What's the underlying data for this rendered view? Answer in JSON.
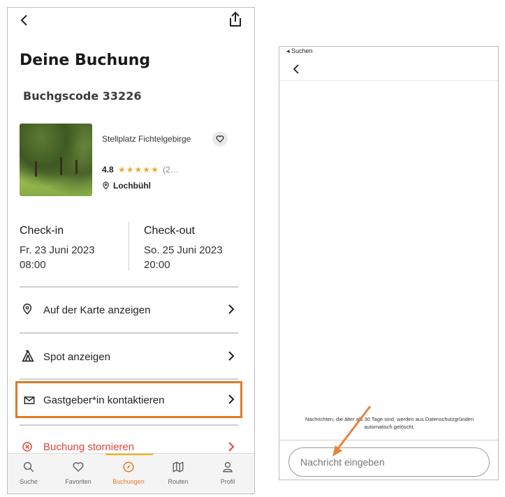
{
  "left_screen": {
    "title": "Deine Buchung",
    "booking_code": "Buchgscode 33226",
    "spot": {
      "name": "Stellplatz Fichtelgebirge",
      "rating": "4.8",
      "stars": "★★★★★",
      "rating_count": "(2…",
      "location": "Lochbühl"
    },
    "checkin": {
      "label": "Check-in",
      "date": "Fr. 23 Juni 2023",
      "time": "08:00"
    },
    "checkout": {
      "label": "Check-out",
      "date": "So. 25 Juni 2023",
      "time": "20:00"
    },
    "actions": [
      {
        "label": "Auf der Karte anzeigen",
        "icon": "map-pin-icon"
      },
      {
        "label": "Spot anzeigen",
        "icon": "tent-icon"
      },
      {
        "label": "Gastgeber*in kontaktieren",
        "icon": "mail-icon"
      },
      {
        "label": "Buchung stornieren",
        "icon": "cancel-icon"
      }
    ],
    "tabs": [
      {
        "label": "Suche",
        "icon": "search-icon",
        "active": false
      },
      {
        "label": "Favoriten",
        "icon": "heart-icon",
        "active": false
      },
      {
        "label": "Buchungen",
        "icon": "compass-icon",
        "active": true
      },
      {
        "label": "Routen",
        "icon": "map-icon",
        "active": false
      },
      {
        "label": "Profil",
        "icon": "user-icon",
        "active": false
      }
    ],
    "colors": {
      "highlight": "#e07a22",
      "cancel": "#e0443a",
      "accent": "#e07a22"
    }
  },
  "right_screen": {
    "status_back": "◂ Suchen",
    "notice": "Nachrichten, die älter als 30 Tage sind, werden aus Datenschutzgründen automatisch gelöscht.",
    "input_placeholder": "Nachricht eingeben",
    "annotation_color": "#e8833a"
  }
}
